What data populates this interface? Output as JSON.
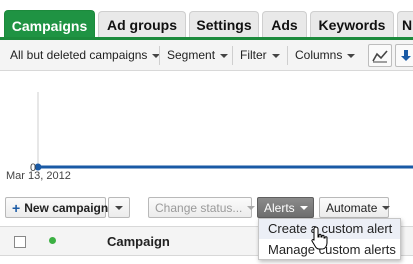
{
  "tabs": [
    {
      "label": "Campaigns",
      "active": true
    },
    {
      "label": "Ad groups",
      "active": false
    },
    {
      "label": "Settings",
      "active": false
    },
    {
      "label": "Ads",
      "active": false
    },
    {
      "label": "Keywords",
      "active": false
    },
    {
      "label": "N",
      "active": false
    }
  ],
  "toolbar": {
    "filter_campaigns": "All but deleted campaigns",
    "segment": "Segment",
    "filter": "Filter",
    "columns": "Columns"
  },
  "chart": {
    "y_zero_label": "0",
    "date_label": "Mar 13, 2012"
  },
  "actions": {
    "new_campaign": "New campaign",
    "change_status": "Change status...",
    "alerts": "Alerts",
    "automate": "Automate"
  },
  "alerts_menu": {
    "items": [
      "Create a custom alert",
      "Manage custom alerts"
    ]
  },
  "table": {
    "campaign_header": "Campaign"
  },
  "colors": {
    "brand_green": "#1f9343",
    "link_blue": "#1a5aa5",
    "status_green": "#3cb043"
  }
}
